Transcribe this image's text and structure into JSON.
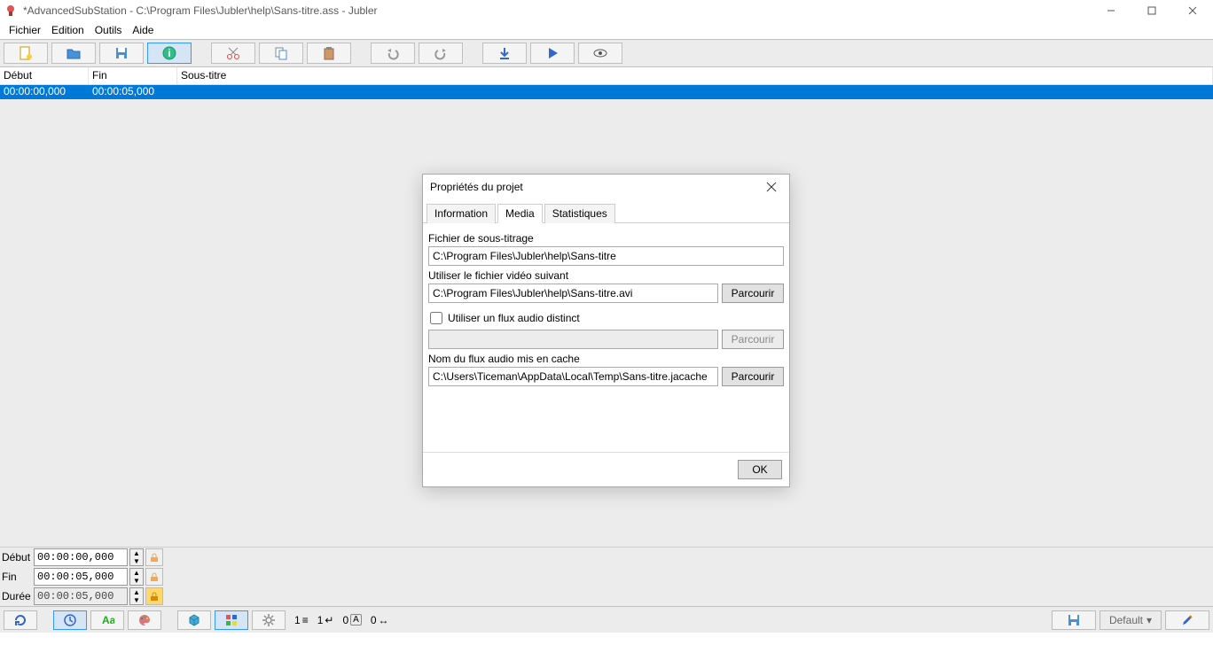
{
  "window": {
    "title": "*AdvancedSubStation - C:\\Program Files\\Jubler\\help\\Sans-titre.ass - Jubler"
  },
  "menu": {
    "items": [
      "Fichier",
      "Edition",
      "Outils",
      "Aide"
    ]
  },
  "table": {
    "headers": {
      "start": "Début",
      "end": "Fin",
      "subtitle": "Sous-titre"
    },
    "rows": [
      {
        "start": "00:00:00,000",
        "end": "00:00:05,000",
        "text": ""
      }
    ]
  },
  "dialog": {
    "title": "Propriétés du projet",
    "tabs": {
      "info": "Information",
      "media": "Media",
      "stats": "Statistiques"
    },
    "subtitle_file_label": "Fichier de sous-titrage",
    "subtitle_file_value": "C:\\Program Files\\Jubler\\help\\Sans-titre",
    "video_label": "Utiliser le fichier vidéo suivant",
    "video_value": "C:\\Program Files\\Jubler\\help\\Sans-titre.avi",
    "browse": "Parcourir",
    "audio_distinct_label": "Utiliser un flux audio distinct",
    "audio_distinct_value": "",
    "audio_cache_label": "Nom du flux audio mis en cache",
    "audio_cache_value": "C:\\Users\\Ticeman\\AppData\\Local\\Temp\\Sans-titre.jacache",
    "ok": "OK"
  },
  "time": {
    "start_label": "Début",
    "end_label": "Fin",
    "duration_label": "Durée",
    "start_value": "00:00:00,000",
    "end_value": "00:00:05,000",
    "duration_value": "00:00:05,000"
  },
  "status": {
    "v1": "1",
    "v2": "1",
    "v3": "0",
    "v4": "0",
    "arrow": "↔"
  },
  "bottombar": {
    "default_label": "Default"
  },
  "colors": {
    "selection": "#0078d7"
  }
}
